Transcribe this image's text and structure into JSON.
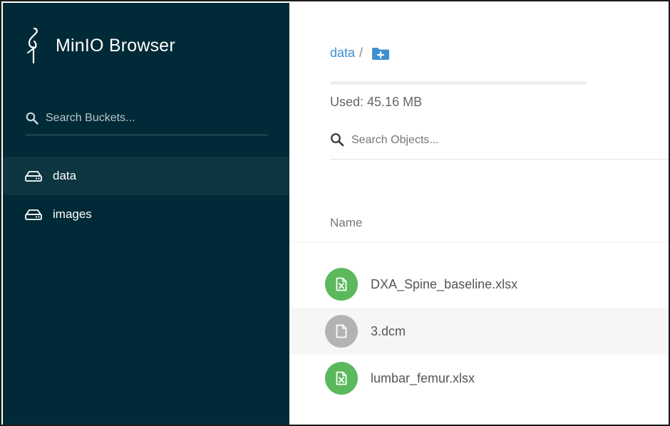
{
  "app": {
    "brand": "MinIO Browser"
  },
  "sidebar": {
    "search": {
      "placeholder": "Search Buckets...",
      "value": ""
    },
    "buckets": [
      {
        "label": "data",
        "active": true
      },
      {
        "label": "images",
        "active": false
      }
    ]
  },
  "main": {
    "breadcrumb": {
      "bucket": "data",
      "separator": "/"
    },
    "usage": {
      "label": "Used:",
      "value": "45.16 MB"
    },
    "search": {
      "placeholder": "Search Objects...",
      "value": ""
    },
    "table": {
      "column_name": "Name",
      "files": [
        {
          "name": "DXA_Spine_baseline.xlsx",
          "icon": "excel-file-icon",
          "type": "xlsx"
        },
        {
          "name": "3.dcm",
          "icon": "generic-file-icon",
          "type": "other"
        },
        {
          "name": "lumbar_femur.xlsx",
          "icon": "excel-file-icon",
          "type": "xlsx"
        }
      ]
    }
  },
  "colors": {
    "sidebar_bg": "#002a37",
    "sidebar_active_bg": "#0d3542",
    "link": "#3d8fd1",
    "xlsx_icon_bg": "#5cb85c",
    "generic_icon_bg": "#b3b3b3"
  }
}
